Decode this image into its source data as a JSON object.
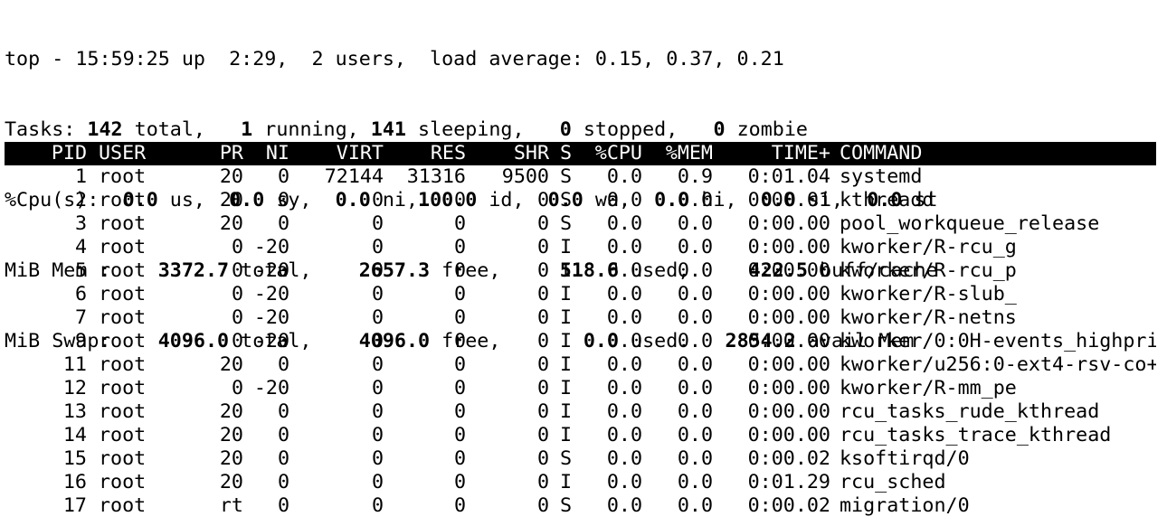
{
  "summary": {
    "line1": "top - 15:59:25 up  2:29,  2 users,  load average: 0.15, 0.37, 0.21",
    "tasks": {
      "prefix": "Tasks: ",
      "total": "142",
      "total_label": " total,   ",
      "running": "1",
      "running_label": " running, ",
      "sleeping": "141",
      "sleeping_label": " sleeping,   ",
      "stopped": "0",
      "stopped_label": " stopped,   ",
      "zombie": "0",
      "zombie_label": " zombie"
    },
    "cpu": {
      "prefix": "%Cpu(s):  ",
      "us": "0.0",
      "us_label": " us,  ",
      "sy": "0.0",
      "sy_label": " sy,  ",
      "ni": "0.0",
      "ni_label": " ni,",
      "id": "100.0",
      "id_label": " id,  ",
      "wa": "0.0",
      "wa_label": " wa,  ",
      "hi": "0.0",
      "hi_label": " hi,  ",
      "si": "0.0",
      "si_label": " si,  ",
      "st": "0.0",
      "st_label": " st"
    },
    "mem": {
      "prefix": "MiB Mem :    ",
      "total": "3372.7",
      "total_label": " total,    ",
      "free": "2657.3",
      "free_label": " free,     ",
      "used": "518.6",
      "used_label": " used,     ",
      "buff": "422.5",
      "buff_label": " buff/cache"
    },
    "swap": {
      "prefix": "MiB Swap:    ",
      "total": "4096.0",
      "total_label": " total,    ",
      "free": "4096.0",
      "free_label": " free,       ",
      "used": "0.0",
      "used_label": " used.   ",
      "avail": "2854.2",
      "avail_label": " avail Mem"
    }
  },
  "columns": {
    "pid": "PID",
    "user": "USER",
    "pr": "PR",
    "ni": "NI",
    "virt": "VIRT",
    "res": "RES",
    "shr": "SHR",
    "s": "S",
    "cpu": "%CPU",
    "mem": "%MEM",
    "time": "TIME+",
    "command": "COMMAND"
  },
  "processes": [
    {
      "pid": "1",
      "user": "root",
      "pr": "20",
      "ni": "0",
      "virt": "72144",
      "res": "31316",
      "shr": "9500",
      "s": "S",
      "cpu": "0.0",
      "mem": "0.9",
      "time": "0:01.04",
      "command": "systemd"
    },
    {
      "pid": "2",
      "user": "root",
      "pr": "20",
      "ni": "0",
      "virt": "0",
      "res": "0",
      "shr": "0",
      "s": "S",
      "cpu": "0.0",
      "mem": "0.0",
      "time": "0:00.01",
      "command": "kthreadd"
    },
    {
      "pid": "3",
      "user": "root",
      "pr": "20",
      "ni": "0",
      "virt": "0",
      "res": "0",
      "shr": "0",
      "s": "S",
      "cpu": "0.0",
      "mem": "0.0",
      "time": "0:00.00",
      "command": "pool_workqueue_release"
    },
    {
      "pid": "4",
      "user": "root",
      "pr": "0",
      "ni": "-20",
      "virt": "0",
      "res": "0",
      "shr": "0",
      "s": "I",
      "cpu": "0.0",
      "mem": "0.0",
      "time": "0:00.00",
      "command": "kworker/R-rcu_g"
    },
    {
      "pid": "5",
      "user": "root",
      "pr": "0",
      "ni": "-20",
      "virt": "0",
      "res": "0",
      "shr": "0",
      "s": "I",
      "cpu": "0.0",
      "mem": "0.0",
      "time": "0:00.00",
      "command": "kworker/R-rcu_p"
    },
    {
      "pid": "6",
      "user": "root",
      "pr": "0",
      "ni": "-20",
      "virt": "0",
      "res": "0",
      "shr": "0",
      "s": "I",
      "cpu": "0.0",
      "mem": "0.0",
      "time": "0:00.00",
      "command": "kworker/R-slub_"
    },
    {
      "pid": "7",
      "user": "root",
      "pr": "0",
      "ni": "-20",
      "virt": "0",
      "res": "0",
      "shr": "0",
      "s": "I",
      "cpu": "0.0",
      "mem": "0.0",
      "time": "0:00.00",
      "command": "kworker/R-netns"
    },
    {
      "pid": "9",
      "user": "root",
      "pr": "0",
      "ni": "-20",
      "virt": "0",
      "res": "0",
      "shr": "0",
      "s": "I",
      "cpu": "0.0",
      "mem": "0.0",
      "time": "0:00.00",
      "command": "kworker/0:0H-events_highpri"
    },
    {
      "pid": "11",
      "user": "root",
      "pr": "20",
      "ni": "0",
      "virt": "0",
      "res": "0",
      "shr": "0",
      "s": "I",
      "cpu": "0.0",
      "mem": "0.0",
      "time": "0:00.00",
      "command": "kworker/u256:0-ext4-rsv-co+"
    },
    {
      "pid": "12",
      "user": "root",
      "pr": "0",
      "ni": "-20",
      "virt": "0",
      "res": "0",
      "shr": "0",
      "s": "I",
      "cpu": "0.0",
      "mem": "0.0",
      "time": "0:00.00",
      "command": "kworker/R-mm_pe"
    },
    {
      "pid": "13",
      "user": "root",
      "pr": "20",
      "ni": "0",
      "virt": "0",
      "res": "0",
      "shr": "0",
      "s": "I",
      "cpu": "0.0",
      "mem": "0.0",
      "time": "0:00.00",
      "command": "rcu_tasks_rude_kthread"
    },
    {
      "pid": "14",
      "user": "root",
      "pr": "20",
      "ni": "0",
      "virt": "0",
      "res": "0",
      "shr": "0",
      "s": "I",
      "cpu": "0.0",
      "mem": "0.0",
      "time": "0:00.00",
      "command": "rcu_tasks_trace_kthread"
    },
    {
      "pid": "15",
      "user": "root",
      "pr": "20",
      "ni": "0",
      "virt": "0",
      "res": "0",
      "shr": "0",
      "s": "S",
      "cpu": "0.0",
      "mem": "0.0",
      "time": "0:00.02",
      "command": "ksoftirqd/0"
    },
    {
      "pid": "16",
      "user": "root",
      "pr": "20",
      "ni": "0",
      "virt": "0",
      "res": "0",
      "shr": "0",
      "s": "I",
      "cpu": "0.0",
      "mem": "0.0",
      "time": "0:01.29",
      "command": "rcu_sched"
    },
    {
      "pid": "17",
      "user": "root",
      "pr": "rt",
      "ni": "0",
      "virt": "0",
      "res": "0",
      "shr": "0",
      "s": "S",
      "cpu": "0.0",
      "mem": "0.0",
      "time": "0:00.02",
      "command": "migration/0"
    }
  ],
  "colors": {
    "background": "#ffffff",
    "text": "#000000",
    "header_bg": "#000000",
    "header_text": "#ffffff"
  }
}
